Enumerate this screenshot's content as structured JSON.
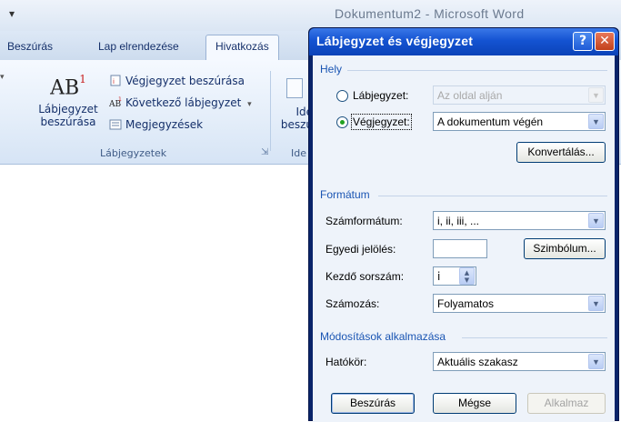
{
  "word": {
    "qat_arrow": "≡",
    "app_title": "Dokumentum2 - Microsoft Word",
    "tabs": [
      "Beszúrás",
      "Lap elrendezése",
      "Hivatkozás"
    ],
    "ribbon": {
      "big_button_icon_text": "AB",
      "big_button_icon_sup": "1",
      "big_button_label_line1": "Lábjegyzet",
      "big_button_label_line2": "beszúrása",
      "small_commands": [
        "Végjegyzet beszúrása",
        "Következő lábjegyzet",
        "Megjegyzések"
      ],
      "group_label": "Lábjegyzetek",
      "partial_label_line1": "Ide",
      "partial_label_line2": "beszú",
      "partial_group_label": "Ide"
    }
  },
  "dialog": {
    "title": "Lábjegyzet és végjegyzet",
    "help_glyph": "?",
    "close_glyph": "✕",
    "location": {
      "section_title": "Hely",
      "footnote_label": "Lábjegyzet:",
      "footnote_value": "Az oldal alján",
      "endnote_label": "Végjegyzet:",
      "endnote_value": "A dokumentum végén",
      "convert_button": "Konvertálás..."
    },
    "format": {
      "section_title": "Formátum",
      "number_format_label": "Számformátum:",
      "number_format_value": "i, ii, iii, ...",
      "custom_mark_label": "Egyedi jelölés:",
      "custom_mark_value": "",
      "symbol_button": "Szimbólum...",
      "start_at_label": "Kezdő sorszám:",
      "start_at_value": "i",
      "numbering_label": "Számozás:",
      "numbering_value": "Folyamatos"
    },
    "apply": {
      "section_title": "Módosítások alkalmazása",
      "scope_label": "Hatókör:",
      "scope_value": "Aktuális szakasz"
    },
    "buttons": {
      "insert": "Beszúrás",
      "cancel": "Mégse",
      "apply": "Alkalmaz"
    }
  }
}
